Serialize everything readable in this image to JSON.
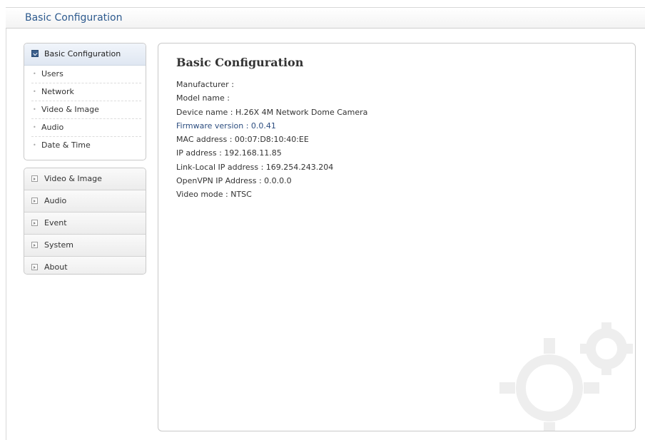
{
  "topbar": {
    "title": "Basic Configuration"
  },
  "sidebar": {
    "active_group": {
      "label": "Basic Configuration",
      "icon": "checked-box-icon",
      "items": [
        {
          "label": "Users"
        },
        {
          "label": "Network"
        },
        {
          "label": "Video & Image"
        },
        {
          "label": "Audio"
        },
        {
          "label": "Date & Time"
        }
      ]
    },
    "menu": [
      {
        "label": "Video & Image"
      },
      {
        "label": "Audio"
      },
      {
        "label": "Event"
      },
      {
        "label": "System"
      },
      {
        "label": "About"
      }
    ]
  },
  "main": {
    "title": "Basic Configuration",
    "info": [
      "Manufacturer :",
      "Model name :",
      "Device name : H.26X 4M Network Dome Camera",
      "Firmware version : 0.0.41",
      "MAC address : 00:07:D8:10:40:EE",
      "IP address : 192.168.11.85",
      "Link-Local IP address : 169.254.243.204",
      "OpenVPN IP Address : 0.0.0.0",
      "Video mode : NTSC"
    ]
  },
  "colors": {
    "accent": "#2d5a8e",
    "link": "#2d4e80",
    "border": "#c9c9c9"
  }
}
